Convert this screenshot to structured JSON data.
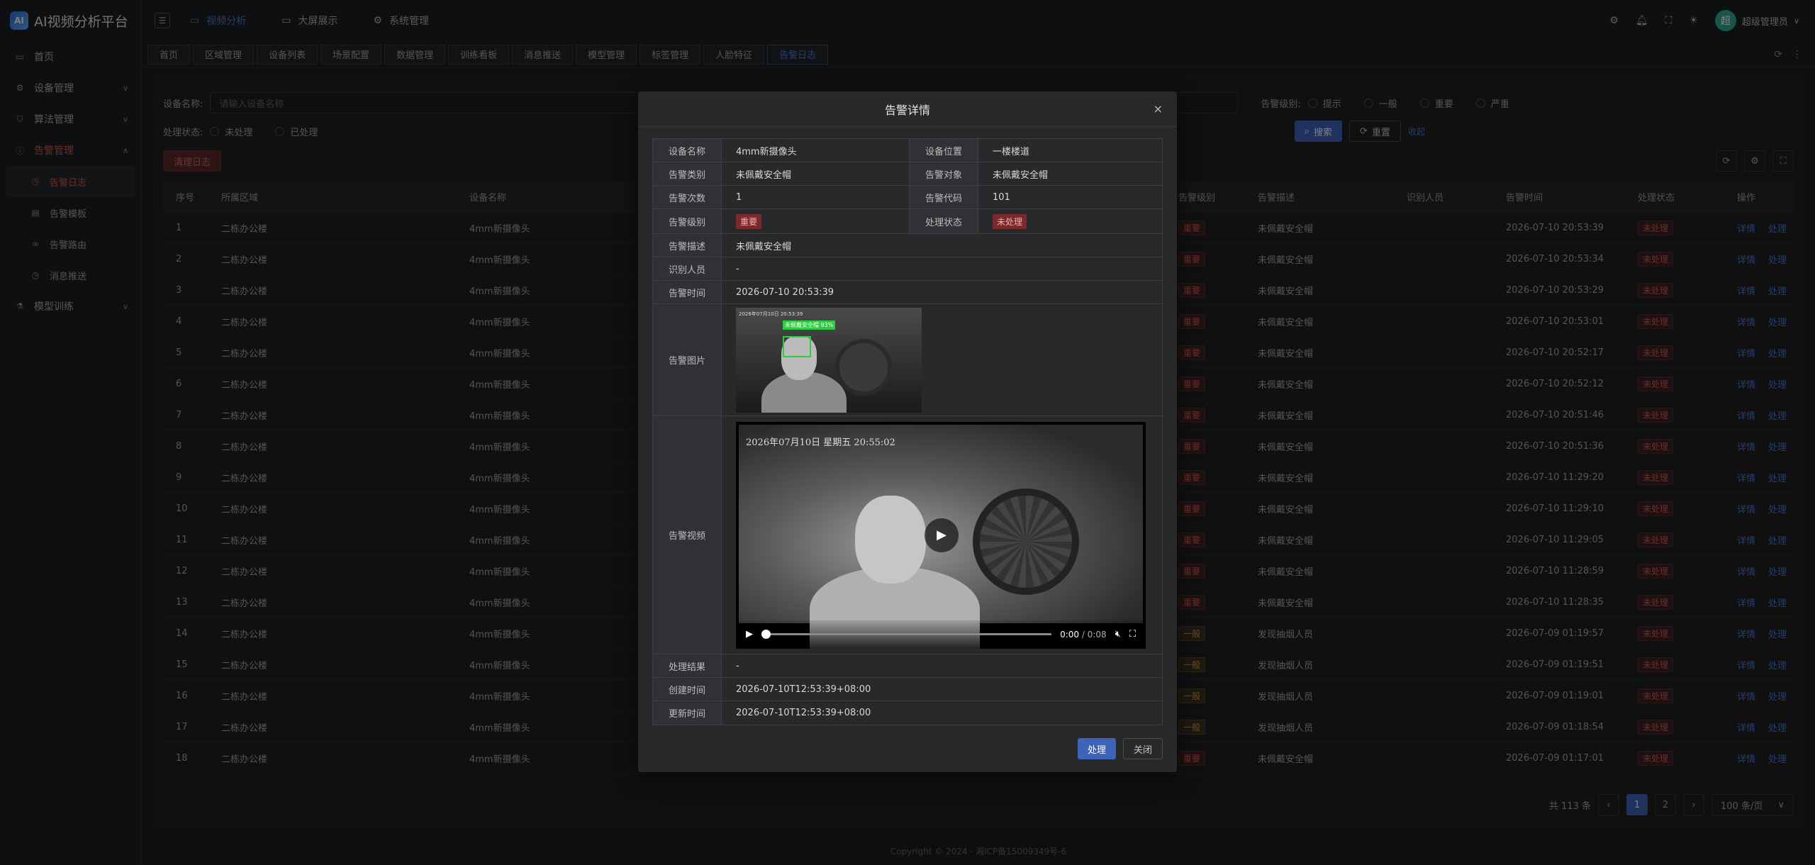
{
  "app": {
    "logo_text": "AI视频分析平台",
    "logo_mark": "AI"
  },
  "sidebar": {
    "items": [
      {
        "label": "首页",
        "icon": "monitor-icon"
      },
      {
        "label": "设备管理",
        "icon": "gear-icon"
      },
      {
        "label": "算法管理",
        "icon": "shield-icon"
      },
      {
        "label": "告警管理",
        "icon": "alert-icon"
      },
      {
        "label": "告警日志",
        "icon": "clock-icon"
      },
      {
        "label": "告警模板",
        "icon": "doc-icon"
      },
      {
        "label": "告警路由",
        "icon": "link-icon"
      },
      {
        "label": "消息推送",
        "icon": "clock-icon"
      },
      {
        "label": "模型训练",
        "icon": "flask-icon"
      }
    ]
  },
  "topnav": {
    "items": [
      "视频分析",
      "大屏展示",
      "系统管理"
    ],
    "user": "超级管理员",
    "avatar": "超"
  },
  "tabs": [
    "首页",
    "区域管理",
    "设备列表",
    "场景配置",
    "数据管理",
    "训练看板",
    "消息推送",
    "模型管理",
    "标签管理",
    "人脸特征",
    "告警日志"
  ],
  "filters": {
    "device_label": "设备名称:",
    "device_placeholder": "请输入设备名称",
    "status_label": "处理状态:",
    "status_opts": [
      "未处理",
      "已处理"
    ],
    "level_label": "告警级别:",
    "level_opts": [
      "提示",
      "一般",
      "重要",
      "严重"
    ],
    "search": "搜索",
    "reset": "重置",
    "collapse": "收起",
    "clear": "清理日志"
  },
  "table": {
    "headers": [
      "序号",
      "所属区域",
      "设备名称",
      "告警级别",
      "告警描述",
      "识别人员",
      "告警时间",
      "处理状态",
      "操作"
    ],
    "actions": [
      "详情",
      "处理"
    ],
    "rows": [
      [
        "1",
        "二栋办公楼",
        "4mm新摄像头",
        "重要",
        "未佩戴安全帽",
        "",
        "2026-07-10 20:53:39",
        "未处理"
      ],
      [
        "2",
        "二栋办公楼",
        "4mm新摄像头",
        "重要",
        "未佩戴安全帽",
        "",
        "2026-07-10 20:53:34",
        "未处理"
      ],
      [
        "3",
        "二栋办公楼",
        "4mm新摄像头",
        "重要",
        "未佩戴安全帽",
        "",
        "2026-07-10 20:53:29",
        "未处理"
      ],
      [
        "4",
        "二栋办公楼",
        "4mm新摄像头",
        "重要",
        "未佩戴安全帽",
        "",
        "2026-07-10 20:53:01",
        "未处理"
      ],
      [
        "5",
        "二栋办公楼",
        "4mm新摄像头",
        "重要",
        "未佩戴安全帽",
        "",
        "2026-07-10 20:52:17",
        "未处理"
      ],
      [
        "6",
        "二栋办公楼",
        "4mm新摄像头",
        "重要",
        "未佩戴安全帽",
        "",
        "2026-07-10 20:52:12",
        "未处理"
      ],
      [
        "7",
        "二栋办公楼",
        "4mm新摄像头",
        "重要",
        "未佩戴安全帽",
        "",
        "2026-07-10 20:51:46",
        "未处理"
      ],
      [
        "8",
        "二栋办公楼",
        "4mm新摄像头",
        "重要",
        "未佩戴安全帽",
        "",
        "2026-07-10 20:51:36",
        "未处理"
      ],
      [
        "9",
        "二栋办公楼",
        "4mm新摄像头",
        "重要",
        "未佩戴安全帽",
        "",
        "2026-07-10 11:29:20",
        "未处理"
      ],
      [
        "10",
        "二栋办公楼",
        "4mm新摄像头",
        "重要",
        "未佩戴安全帽",
        "",
        "2026-07-10 11:29:10",
        "未处理"
      ],
      [
        "11",
        "二栋办公楼",
        "4mm新摄像头",
        "重要",
        "未佩戴安全帽",
        "",
        "2026-07-10 11:29:05",
        "未处理"
      ],
      [
        "12",
        "二栋办公楼",
        "4mm新摄像头",
        "重要",
        "未佩戴安全帽",
        "",
        "2026-07-10 11:28:59",
        "未处理"
      ],
      [
        "13",
        "二栋办公楼",
        "4mm新摄像头",
        "重要",
        "未佩戴安全帽",
        "",
        "2026-07-10 11:28:35",
        "未处理"
      ],
      [
        "14",
        "二栋办公楼",
        "4mm新摄像头",
        "一般",
        "发现抽烟人员",
        "",
        "2026-07-09 01:19:57",
        "未处理"
      ],
      [
        "15",
        "二栋办公楼",
        "4mm新摄像头",
        "一般",
        "发现抽烟人员",
        "",
        "2026-07-09 01:19:51",
        "未处理"
      ],
      [
        "16",
        "二栋办公楼",
        "4mm新摄像头",
        "一般",
        "发现抽烟人员",
        "",
        "2026-07-09 01:19:01",
        "未处理"
      ],
      [
        "17",
        "二栋办公楼",
        "4mm新摄像头",
        "一般",
        "发现抽烟人员",
        "",
        "2026-07-09 01:18:54",
        "未处理"
      ],
      [
        "18",
        "二栋办公楼",
        "4mm新摄像头",
        "重要",
        "未佩戴安全帽",
        "",
        "2026-07-09 01:17:01",
        "未处理"
      ]
    ]
  },
  "pager": {
    "total": "共 113 条",
    "pages": [
      "1",
      "2"
    ],
    "size": "100 条/页"
  },
  "footer": "Copyright © 2024 · 湘ICP备15009349号-6",
  "modal": {
    "title": "告警详情",
    "f": {
      "name_l": "设备名称",
      "name_v": "4mm新摄像头",
      "loc_l": "设备位置",
      "loc_v": "一楼楼道",
      "type_l": "告警类别",
      "type_v": "未佩戴安全帽",
      "obj_l": "告警对象",
      "obj_v": "未佩戴安全帽",
      "count_l": "告警次数",
      "count_v": "1",
      "code_l": "告警代码",
      "code_v": "101",
      "level_l": "告警级别",
      "level_v": "重要",
      "status_l": "处理状态",
      "status_v": "未处理",
      "desc_l": "告警描述",
      "desc_v": "未佩戴安全帽",
      "person_l": "识别人员",
      "person_v": "-",
      "time_l": "告警时间",
      "time_v": "2026-07-10 20:53:39",
      "img_l": "告警图片",
      "img_label": "未佩戴安全帽 93%",
      "img_ts": "2026年07月10日 20:53:39",
      "video_l": "告警视频",
      "video_ts": "2026年07月10日 星期五 20:55:02",
      "video_time": "0:00",
      "video_dur": "/ 0:08",
      "result_l": "处理结果",
      "result_v": "-",
      "created_l": "创建时间",
      "created_v": "2026-07-10T12:53:39+08:00",
      "updated_l": "更新时间",
      "updated_v": "2026-07-10T12:53:39+08:00"
    },
    "btn_handle": "处理",
    "btn_close": "关闭"
  }
}
